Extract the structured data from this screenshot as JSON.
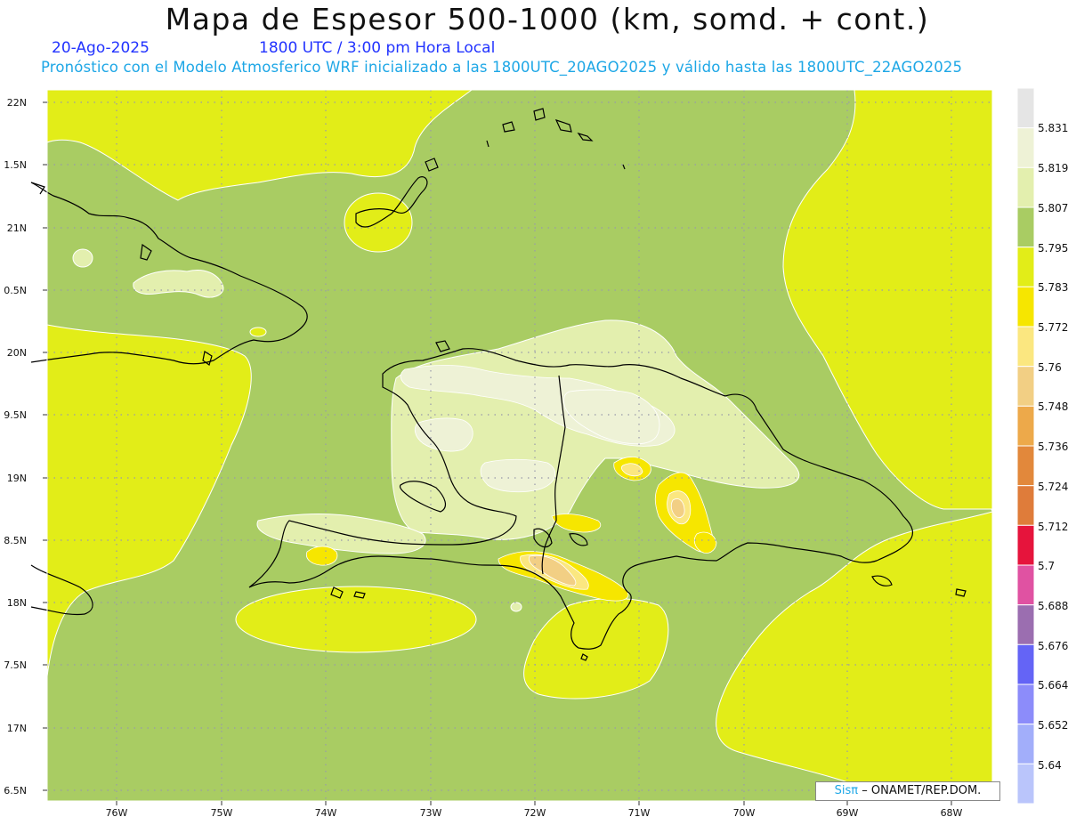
{
  "header": {
    "title": "Mapa de Espesor 500-1000 (km, somd. + cont.)",
    "date": "20-Ago-2025",
    "time": "1800 UTC / 3:00 pm Hora Local",
    "description": "Pronóstico con el Modelo Atmosferico WRF inicializado a las 1800UTC_20AGO2025 y válido hasta las  1800UTC_22AGO2025"
  },
  "axes": {
    "lat_labels": [
      "22N",
      "1.5N",
      "21N",
      "0.5N",
      "20N",
      "9.5N",
      "19N",
      "8.5N",
      "18N",
      "7.5N",
      "17N",
      "6.5N"
    ],
    "lon_labels": [
      "76W",
      "75W",
      "74W",
      "73W",
      "72W",
      "71W",
      "70W",
      "69W",
      "68W"
    ]
  },
  "legend": {
    "levels": [
      "5.831",
      "5.819",
      "5.807",
      "5.795",
      "5.783",
      "5.772",
      "5.76",
      "5.748",
      "5.736",
      "5.724",
      "5.712",
      "5.7",
      "5.688",
      "5.676",
      "5.664",
      "5.652",
      "5.64"
    ],
    "colors": [
      "#e5e5e5",
      "#eef2d6",
      "#e3efae",
      "#a9cc63",
      "#e2ed18",
      "#f6e600",
      "#fbe780",
      "#f2cf84",
      "#eda94a",
      "#e2883b",
      "#df7c3a",
      "#e6143c",
      "#e052a2",
      "#9b6eb0",
      "#6464f6",
      "#8c8cfa",
      "#a2aefa",
      "#bac5fb"
    ]
  },
  "credit": {
    "brand": "Sisπ",
    "text": " ONAMET/REP.DOM."
  },
  "colors": {
    "yellow": "#e2ed18",
    "green": "#a9cc63",
    "light_green": "#e3efae",
    "pale": "#eef2d6",
    "gold": "#f6e600",
    "orange_light": "#f2cf84"
  }
}
